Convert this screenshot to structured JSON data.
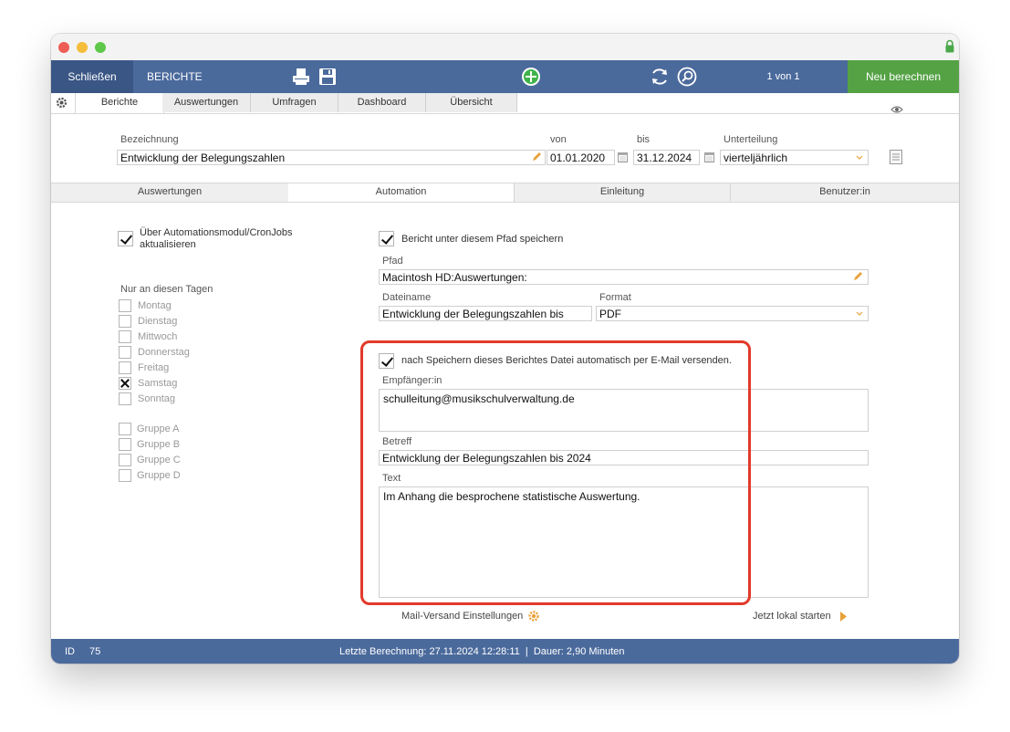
{
  "toolbar": {
    "close_label": "Schließen",
    "title": "BERICHTE",
    "pager": "1 von 1",
    "recalc_label": "Neu berechnen"
  },
  "main_tabs": [
    {
      "label": "Berichte",
      "active": true
    },
    {
      "label": "Auswertungen",
      "active": false
    },
    {
      "label": "Umfragen",
      "active": false
    },
    {
      "label": "Dashboard",
      "active": false
    },
    {
      "label": "Übersicht",
      "active": false
    }
  ],
  "header": {
    "bezeichnung_label": "Bezeichnung",
    "bezeichnung_value": "Entwicklung der Belegungszahlen",
    "von_label": "von",
    "von_value": "01.01.2020",
    "bis_label": "bis",
    "bis_value": "31.12.2024",
    "unterteilung_label": "Unterteilung",
    "unterteilung_value": "vierteljährlich"
  },
  "sub_tabs": [
    {
      "label": "Auswertungen",
      "active": false
    },
    {
      "label": "Automation",
      "active": true
    },
    {
      "label": "Einleitung",
      "active": false
    },
    {
      "label": "Benutzer:in",
      "active": false
    }
  ],
  "automation": {
    "cron_label": "Über Automationsmodul/CronJobs aktualisieren",
    "cron_checked": true,
    "days_heading": "Nur an diesen Tagen",
    "days": [
      {
        "label": "Montag",
        "checked": false
      },
      {
        "label": "Dienstag",
        "checked": false
      },
      {
        "label": "Mittwoch",
        "checked": false
      },
      {
        "label": "Donnerstag",
        "checked": false
      },
      {
        "label": "Freitag",
        "checked": false
      },
      {
        "label": "Samstag",
        "checked": true
      },
      {
        "label": "Sonntag",
        "checked": false
      }
    ],
    "groups": [
      {
        "label": "Gruppe A",
        "checked": false
      },
      {
        "label": "Gruppe B",
        "checked": false
      },
      {
        "label": "Gruppe C",
        "checked": false
      },
      {
        "label": "Gruppe D",
        "checked": false
      }
    ],
    "save_path_label": "Bericht unter diesem Pfad speichern",
    "save_path_checked": true,
    "pfad_label": "Pfad",
    "pfad_value": "Macintosh HD:Auswertungen:",
    "dateiname_label": "Dateiname",
    "dateiname_value": "Entwicklung der Belegungszahlen bis",
    "format_label": "Format",
    "format_value": "PDF",
    "mail_label": "nach Speichern dieses Berichtes Datei automatisch per E-Mail versenden.",
    "mail_checked": true,
    "recipient_label": "Empfänger:in",
    "recipient_value": "schulleitung@musikschulverwaltung.de",
    "subject_label": "Betreff",
    "subject_value": "Entwicklung der Belegungszahlen bis 2024",
    "text_label": "Text",
    "text_value": "Im Anhang die besprochene statistische Auswertung.",
    "mail_settings_label": "Mail-Versand Einstellungen",
    "start_local_label": "Jetzt lokal starten"
  },
  "status": {
    "id_label": "ID",
    "id_value": "75",
    "last_calc": "Letzte Berechnung: 27.11.2024 12:28:11  |  Dauer: 2,90 Minuten"
  },
  "colors": {
    "toolbar_blue": "#4b6a9c",
    "close_blue": "#3a5685",
    "recalc_green": "#54a244",
    "highlight_red": "#e23a2b",
    "pencil_orange": "#e8a23a"
  }
}
